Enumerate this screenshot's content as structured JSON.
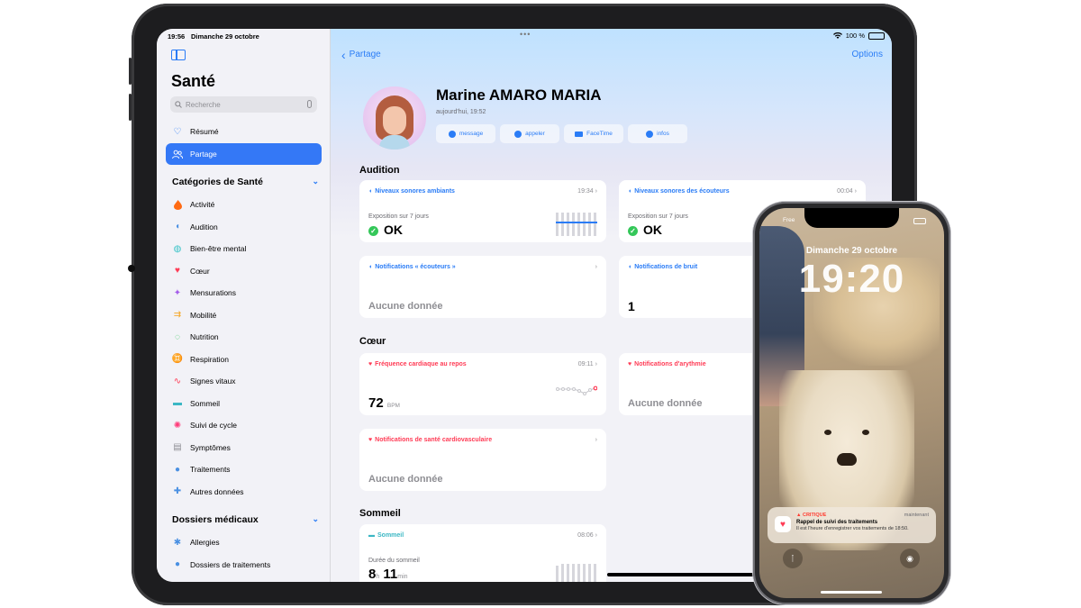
{
  "ipad": {
    "status": {
      "time": "19:56",
      "date": "Dimanche 29 octobre",
      "battery": "100 %",
      "dots": "•••"
    },
    "sidebar": {
      "title": "Santé",
      "search_placeholder": "Recherche",
      "items": [
        {
          "label": "Résumé",
          "icon": "heart-outline-icon"
        },
        {
          "label": "Partage",
          "icon": "people-icon",
          "active": true
        }
      ],
      "categories_header": "Catégories de Santé",
      "categories": [
        {
          "label": "Activité",
          "icon": "flame-icon",
          "color": "#ff6a13"
        },
        {
          "label": "Audition",
          "icon": "ear-icon",
          "color": "#4a90e2"
        },
        {
          "label": "Bien-être mental",
          "icon": "head-icon",
          "color": "#38c3c7"
        },
        {
          "label": "Cœur",
          "icon": "heart-icon",
          "color": "#ff3b55"
        },
        {
          "label": "Mensurations",
          "icon": "figure-icon",
          "color": "#a55eea"
        },
        {
          "label": "Mobilité",
          "icon": "arrows-icon",
          "color": "#f5a623"
        },
        {
          "label": "Nutrition",
          "icon": "apple-icon",
          "color": "#34c759"
        },
        {
          "label": "Respiration",
          "icon": "lungs-icon",
          "color": "#4a90e2"
        },
        {
          "label": "Signes vitaux",
          "icon": "waveform-icon",
          "color": "#ff3b55"
        },
        {
          "label": "Sommeil",
          "icon": "bed-icon",
          "color": "#3bb7c4"
        },
        {
          "label": "Suivi de cycle",
          "icon": "cycle-icon",
          "color": "#ff3b7a"
        },
        {
          "label": "Symptômes",
          "icon": "clipboard-icon",
          "color": "#8e8e93"
        },
        {
          "label": "Traitements",
          "icon": "pills-icon",
          "color": "#4a90e2"
        },
        {
          "label": "Autres données",
          "icon": "plus-icon",
          "color": "#4a90e2"
        }
      ],
      "records_header": "Dossiers médicaux",
      "records": [
        {
          "label": "Allergies",
          "icon": "allergy-icon",
          "color": "#4a90e2"
        },
        {
          "label": "Dossiers de traitements",
          "icon": "pills-icon",
          "color": "#4a90e2"
        }
      ]
    },
    "main": {
      "back_label": "Partage",
      "options_label": "Options",
      "person": {
        "name": "Marine AMARO MARIA",
        "updated": "aujourd'hui, 19:52"
      },
      "actions": [
        {
          "label": "message",
          "icon": "message-icon"
        },
        {
          "label": "appeler",
          "icon": "phone-icon"
        },
        {
          "label": "FaceTime",
          "icon": "video-icon"
        },
        {
          "label": "infos",
          "icon": "person-circle-icon"
        }
      ],
      "audition": {
        "title": "Audition",
        "ambient": {
          "title": "Niveaux sonores ambiants",
          "time": "19:34",
          "sub": "Exposition sur 7 jours",
          "value": "OK"
        },
        "headphones": {
          "title": "Niveaux sonores des écouteurs",
          "time": "00:04",
          "sub": "Exposition sur 7 jours",
          "value": "OK"
        },
        "headphone_notifs": {
          "title": "Notifications « écouteurs »",
          "value": "Aucune donnée"
        },
        "noise_notifs": {
          "title": "Notifications de bruit",
          "value": "1"
        }
      },
      "coeur": {
        "title": "Cœur",
        "resting_hr": {
          "title": "Fréquence cardiaque au repos",
          "time": "09:11",
          "value": "72",
          "unit": "BPM"
        },
        "arrhythmia": {
          "title": "Notifications d'arythmie",
          "value": "Aucune donnée"
        },
        "cardio": {
          "title": "Notifications de santé cardiovasculaire",
          "value": "Aucune donnée"
        }
      },
      "sommeil": {
        "title": "Sommeil",
        "card": {
          "title": "Sommeil",
          "time": "08:06",
          "sub": "Durée du sommeil",
          "hours": "8",
          "h_unit": "h",
          "minutes": "11",
          "m_unit": "min"
        }
      }
    }
  },
  "iphone": {
    "carrier": "Free",
    "date": "Dimanche 29 octobre",
    "time": "19:20",
    "notification": {
      "tag": "CRITIQUE",
      "when": "maintenant",
      "title": "Rappel de suivi des traitements",
      "body": "Il est l'heure d'enregistrer vos traitements de 18:50."
    }
  }
}
